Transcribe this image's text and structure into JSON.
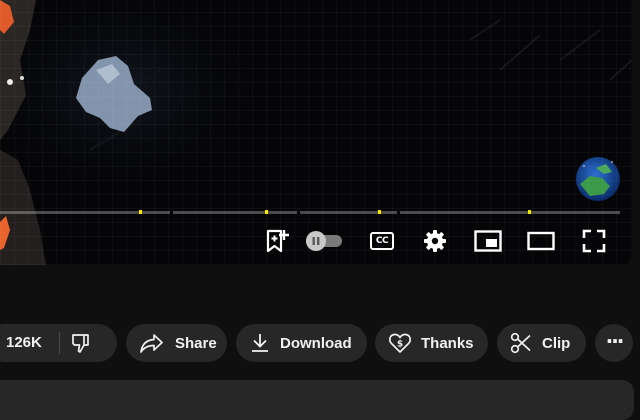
{
  "player": {
    "progress_markers": 4,
    "controls": {
      "save_playlist": "save-to-playlist-icon",
      "autoplay": "autoplay-toggle",
      "captions": "CC",
      "settings": "gear-icon",
      "miniplayer": "miniplayer-icon",
      "theater": "theater-mode-icon",
      "fullscreen": "fullscreen-icon"
    }
  },
  "actions": {
    "like_count": "126K",
    "share_label": "Share",
    "download_label": "Download",
    "thanks_label": "Thanks",
    "clip_label": "Clip",
    "more_label": "···"
  },
  "colors": {
    "background": "#0f0f0f",
    "pill": "#272727",
    "chapter_marker": "#f4e800"
  }
}
